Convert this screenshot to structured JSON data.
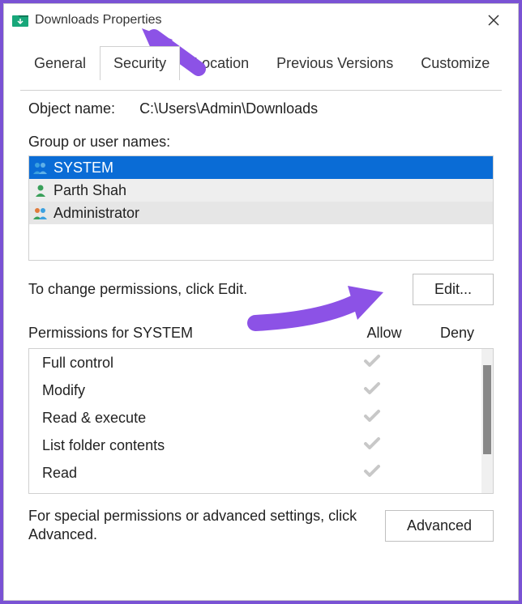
{
  "window": {
    "title": "Downloads Properties"
  },
  "tabs": {
    "items": [
      {
        "label": "General"
      },
      {
        "label": "Security"
      },
      {
        "label": "Location"
      },
      {
        "label": "Previous Versions"
      },
      {
        "label": "Customize"
      }
    ]
  },
  "object": {
    "label": "Object name:",
    "value": "C:\\Users\\Admin\\Downloads"
  },
  "group_label": "Group or user names:",
  "users": {
    "items": [
      {
        "label": "SYSTEM"
      },
      {
        "label": "Parth Shah"
      },
      {
        "label": "Administrator"
      }
    ]
  },
  "edit_hint": "To change permissions, click Edit.",
  "edit_button": "Edit...",
  "perm_header": {
    "title": "Permissions for SYSTEM",
    "allow": "Allow",
    "deny": "Deny"
  },
  "permissions": [
    {
      "name": "Full control",
      "allow": true,
      "deny": false
    },
    {
      "name": "Modify",
      "allow": true,
      "deny": false
    },
    {
      "name": "Read & execute",
      "allow": true,
      "deny": false
    },
    {
      "name": "List folder contents",
      "allow": true,
      "deny": false
    },
    {
      "name": "Read",
      "allow": true,
      "deny": false
    }
  ],
  "advanced_hint": "For special permissions or advanced settings, click Advanced.",
  "advanced_button": "Advanced",
  "annotation_color": "#8c52e6"
}
